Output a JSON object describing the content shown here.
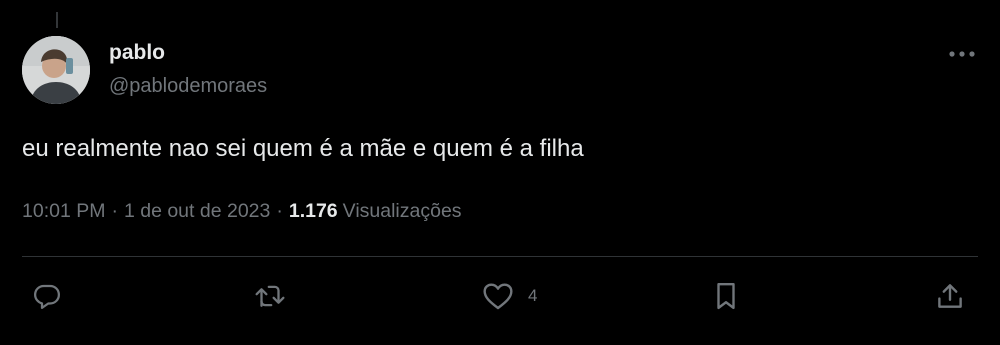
{
  "tweet": {
    "author": {
      "display_name": "pablo",
      "handle": "@pablodemoraes",
      "avatar_icon": "profile-photo"
    },
    "text": "eu realmente nao sei quem é a mãe e quem é a filha",
    "timestamp": "10:01 PM",
    "separator": "·",
    "date": "1 de out de 2023",
    "views": {
      "count": "1.176",
      "label": "Visualizações"
    },
    "actions": {
      "reply": {
        "icon": "reply-icon"
      },
      "retweet": {
        "icon": "retweet-icon"
      },
      "like": {
        "icon": "heart-icon",
        "count": "4"
      },
      "bookmark": {
        "icon": "bookmark-icon"
      },
      "share": {
        "icon": "share-icon"
      }
    },
    "more_icon": "more-icon"
  },
  "colors": {
    "background": "#000000",
    "primary_text": "#e7e9ea",
    "secondary_text": "#71767b",
    "divider": "#2f3336"
  }
}
